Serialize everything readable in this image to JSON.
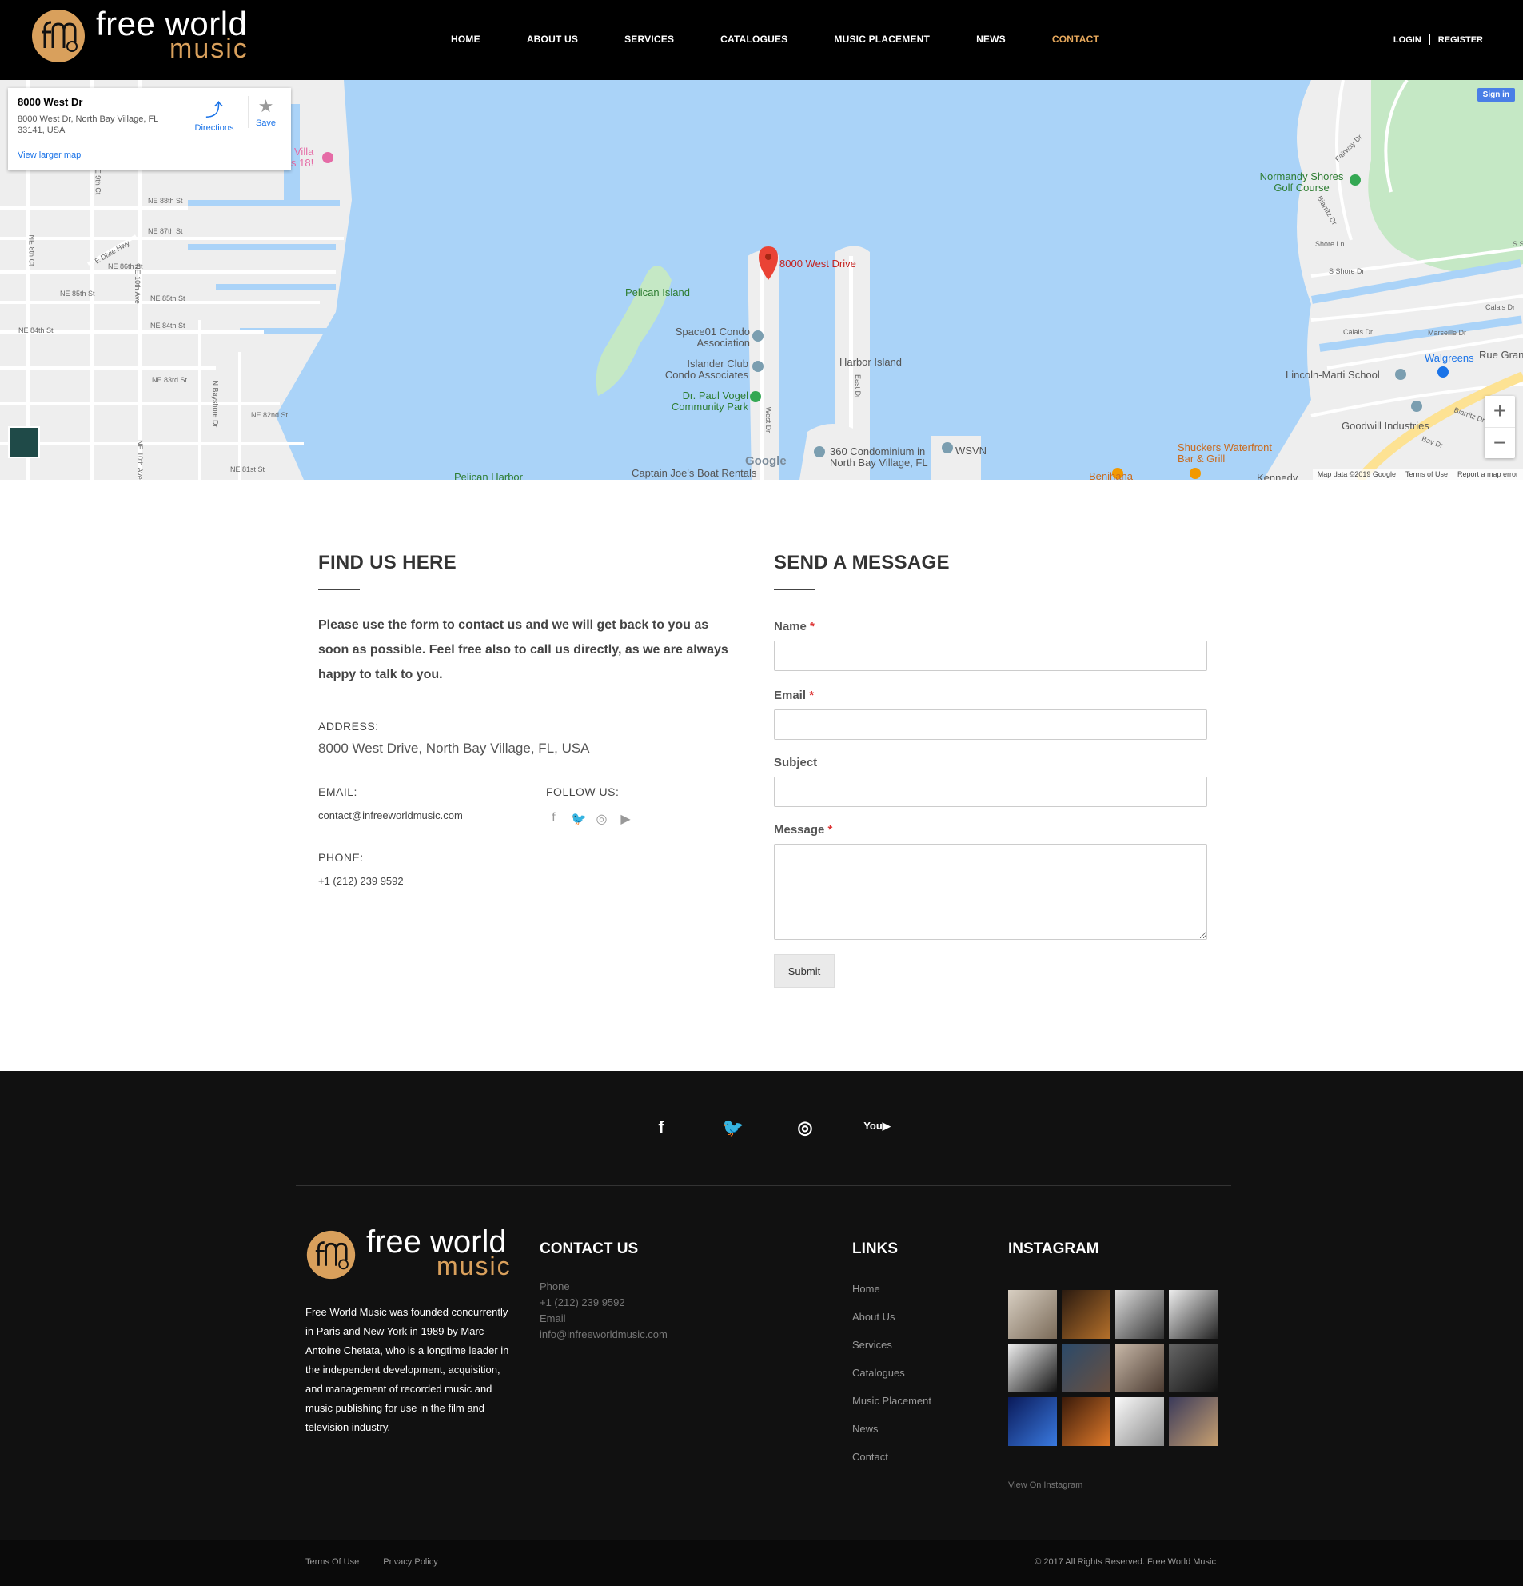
{
  "header": {
    "logo_word1": "free world",
    "logo_word2": "music",
    "nav": [
      "HOME",
      "ABOUT US",
      "SERVICES",
      "CATALOGUES",
      "MUSIC PLACEMENT",
      "NEWS",
      "CONTACT"
    ],
    "active_nav": "CONTACT",
    "login": "LOGIN",
    "register": "REGISTER",
    "accent_color": "#e6a85c"
  },
  "map": {
    "card_title": "8000 West Dr",
    "card_address": "8000 West Dr, North Bay Village, FL 33141, USA",
    "directions": "Directions",
    "save": "Save",
    "view_larger": "View larger map",
    "sign_in": "Sign in",
    "zoom_in": "+",
    "zoom_out": "−",
    "pin_label": "8000 West Drive",
    "labels": {
      "pelican_island": "Pelican Island",
      "space01": "Space01 Condo Association",
      "islander": "Islander Club Condo Associates",
      "paul_vogel": "Dr. Paul Vogel Community Park",
      "harbor_island": "Harbor Island",
      "condo360": "360 Condominium in North Bay Village, FL",
      "wsvn": "WSVN",
      "captain": "Captain Joe's Boat Rentals",
      "pelican_harbor": "Pelican Harbor",
      "normandy": "Normandy Shores Golf Course",
      "walgreens": "Walgreens",
      "rue": "Rue Granvi",
      "lincoln": "Lincoln-Marti School",
      "goodwill": "Goodwill Industries",
      "shuckers": "Shuckers Waterfront Bar & Grill",
      "benihana": "Benihana",
      "kennedy": "Kennedy",
      "villa": "Villa",
      "s18": "s 18!"
    },
    "streets": {
      "ne88": "NE 88th St",
      "ne87": "NE 87th St",
      "ne86": "NE 86th St",
      "ne85a": "NE 85th St",
      "ne85b": "NE 85th St",
      "ne84a": "NE 84th St",
      "ne84b": "NE 84th St",
      "ne83": "NE 83rd St",
      "ne82": "NE 82nd St",
      "ne81": "NE 81st St",
      "ne10a": "NE 10th Ave",
      "ne10b": "NE 10th Ave",
      "e9": "E 9th Ct",
      "ne8": "NE 8th Ct",
      "dixie": "E Dixie Hwy",
      "bayshore": "N Bayshore Dr",
      "west_dr": "West Dr",
      "east_dr": "East Dr",
      "fairway": "Fairway Dr",
      "biarritz1": "Biarritz Dr",
      "biarritz2": "Biarritz Dr",
      "shore_ln": "Shore Ln",
      "s_shore": "S Shore Dr",
      "calais1": "Calais Dr",
      "calais2": "Calais Dr",
      "marseille": "Marseille Dr",
      "bay": "Bay Dr",
      "ss": "S S"
    },
    "google": "Google",
    "map_data": "Map data ©2019 Google",
    "terms": "Terms of Use",
    "report": "Report a map error",
    "water_color": "#aad3f8",
    "land_color": "#eeeeee",
    "park_color": "#c5e8c5"
  },
  "find": {
    "title": "FIND US HERE",
    "intro": "Please use the form to contact us and we will get back to you as soon as possible. Feel free also to call us directly, as we are always happy to talk to you.",
    "address_label": "ADDRESS:",
    "address": "8000 West Drive, North Bay Village, FL, USA",
    "email_label": "EMAIL:",
    "email": "contact@infreeworldmusic.com",
    "follow_label": "FOLLOW US:",
    "follow_icons": [
      "facebook-icon",
      "twitter-icon",
      "instagram-icon",
      "youtube-icon"
    ],
    "phone_label": "PHONE:",
    "phone": "+1 (212) 239 9592"
  },
  "form": {
    "title": "SEND A MESSAGE",
    "name_label": "Name",
    "email_label": "Email",
    "subject_label": "Subject",
    "message_label": "Message",
    "required_mark": "*",
    "submit": "Submit"
  },
  "footer": {
    "social": [
      "facebook-icon",
      "twitter-icon",
      "instagram-icon",
      "youtube-icon"
    ],
    "logo_word1": "free world",
    "logo_word2": "music",
    "about": "Free World Music was founded concurrently in Paris and New York in 1989 by Marc-Antoine Chetata, who is a longtime leader in the independent development, acquisition, and management of recorded music and music publishing for use in the film and television industry.",
    "contact_title": "CONTACT US",
    "phone_label": "Phone",
    "phone": "+1 (212) 239 9592",
    "email_label": "Email",
    "email": "info@infreeworldmusic.com",
    "links_title": "LINKS",
    "links": [
      "Home",
      "About Us",
      "Services",
      "Catalogues",
      "Music Placement",
      "News",
      "Contact"
    ],
    "instagram_title": "INSTAGRAM",
    "view_instagram": "View On Instagram",
    "terms": "Terms Of Use",
    "privacy": "Privacy Policy",
    "copyright": "© 2017 All Rights Reserved. Free World Music"
  }
}
